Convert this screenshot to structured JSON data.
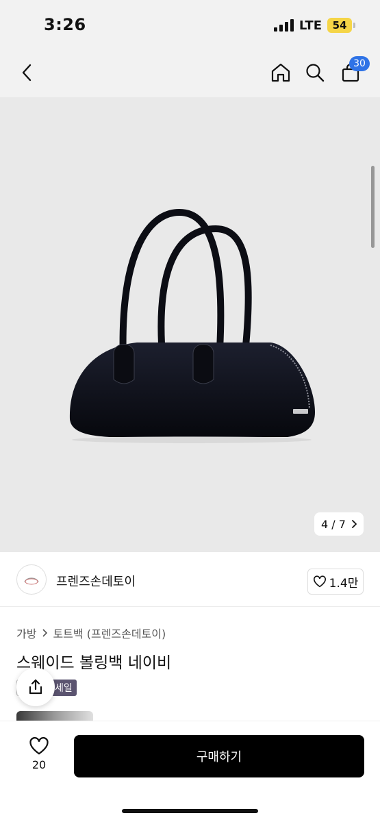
{
  "status": {
    "time": "3:26",
    "network": "LTE",
    "battery": "54"
  },
  "header": {
    "cart_count": "30",
    "icons": [
      "back-icon",
      "home-icon",
      "search-icon",
      "cart-icon"
    ]
  },
  "gallery": {
    "counter": "4 / 7",
    "current": 4,
    "total": 7,
    "background": "#e9e9e9"
  },
  "seller": {
    "name": "프렌즈손데토이",
    "follow_count": "1.4만"
  },
  "product": {
    "breadcrumb": [
      "가방",
      "토트백 (프렌즈손데토이)"
    ],
    "title": "스웨이드 볼링백 네이비",
    "tag": "세일"
  },
  "footer": {
    "like_count": "20",
    "buy_label": "구매하기"
  },
  "colors": {
    "accent": "#2f73e6",
    "buy": "#000000",
    "battery": "#f5d547",
    "tag": "#5b5470"
  }
}
